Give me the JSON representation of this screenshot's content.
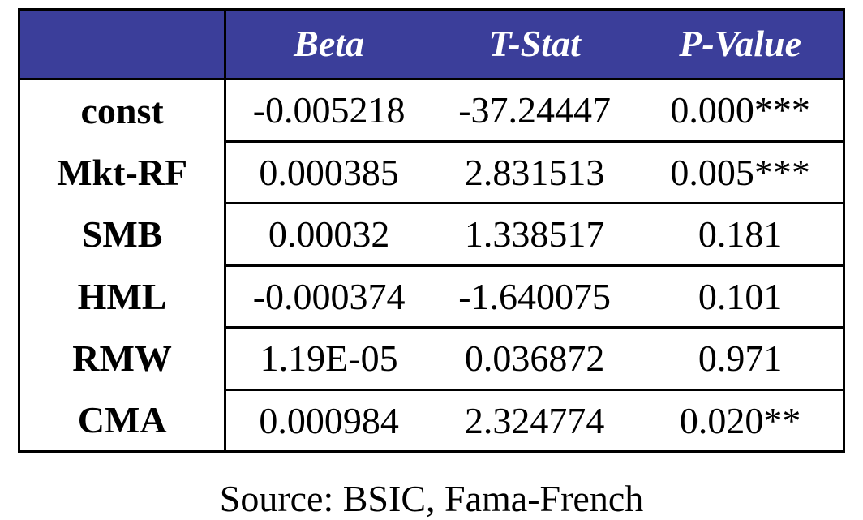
{
  "chart_data": {
    "type": "table",
    "title": "",
    "columns": [
      "",
      "Beta",
      "T-Stat",
      "P-Value"
    ],
    "rows": [
      {
        "label": "const",
        "beta": -0.005218,
        "tstat": -37.24447,
        "pvalue": 0.0,
        "sig": "***"
      },
      {
        "label": "Mkt-RF",
        "beta": 0.000385,
        "tstat": 2.831513,
        "pvalue": 0.005,
        "sig": "***"
      },
      {
        "label": "SMB",
        "beta": 0.00032,
        "tstat": 1.338517,
        "pvalue": 0.181,
        "sig": ""
      },
      {
        "label": "HML",
        "beta": -0.000374,
        "tstat": -1.640075,
        "pvalue": 0.101,
        "sig": ""
      },
      {
        "label": "RMW",
        "beta": 1.19e-05,
        "tstat": 0.036872,
        "pvalue": 0.971,
        "sig": ""
      },
      {
        "label": "CMA",
        "beta": 0.000984,
        "tstat": 2.324774,
        "pvalue": 0.02,
        "sig": "**"
      }
    ],
    "source": "Source: BSIC, Fama-French"
  },
  "header": {
    "blank": "",
    "beta": "Beta",
    "tstat": "T-Stat",
    "pvalue": "P-Value"
  },
  "rows": {
    "0": {
      "label": "const",
      "beta": "-0.005218",
      "tstat": "-37.24447",
      "pvalue": "0.000***"
    },
    "1": {
      "label": "Mkt-RF",
      "beta": "0.000385",
      "tstat": "2.831513",
      "pvalue": "0.005***"
    },
    "2": {
      "label": "SMB",
      "beta": "0.00032",
      "tstat": "1.338517",
      "pvalue": "0.181"
    },
    "3": {
      "label": "HML",
      "beta": "-0.000374",
      "tstat": "-1.640075",
      "pvalue": "0.101"
    },
    "4": {
      "label": "RMW",
      "beta": "1.19E-05",
      "tstat": "0.036872",
      "pvalue": "0.971"
    },
    "5": {
      "label": "CMA",
      "beta": "0.000984",
      "tstat": "2.324774",
      "pvalue": "0.020**"
    }
  },
  "source": "Source: BSIC, Fama-French"
}
